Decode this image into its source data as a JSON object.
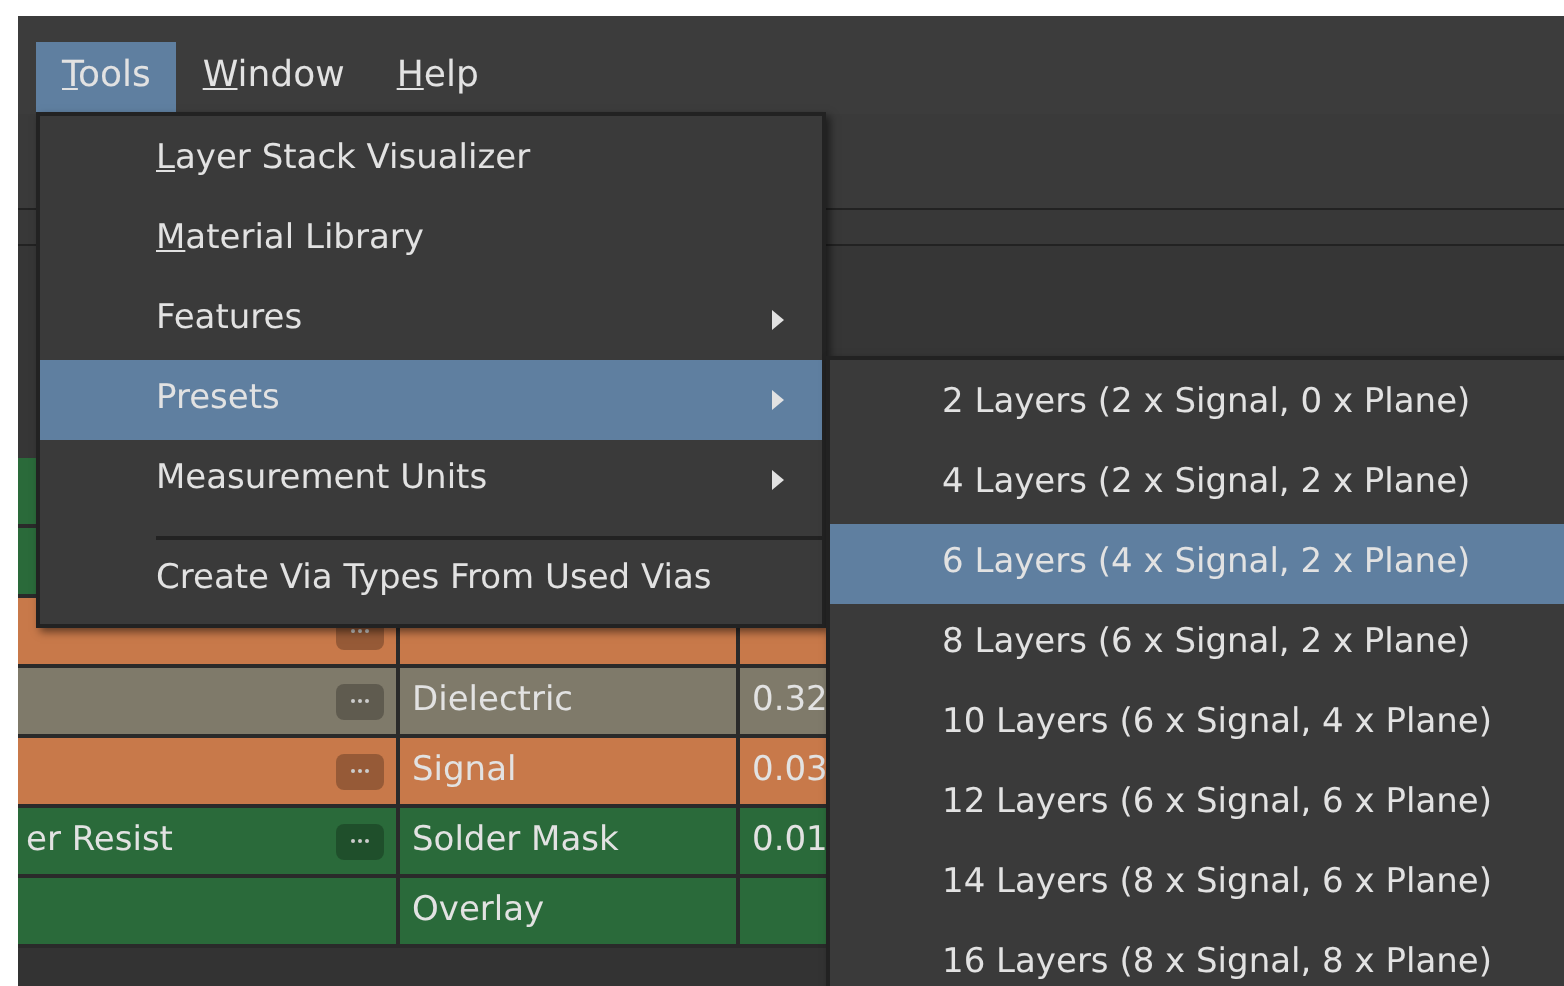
{
  "menu_bar": [
    {
      "label": "Tools",
      "underline_first": true,
      "selected": true
    },
    {
      "label": "Window",
      "underline_first": true,
      "selected": false
    },
    {
      "label": "Help",
      "underline_first": true,
      "selected": false
    }
  ],
  "table": {
    "rows": [
      {
        "color": "#2a6a3a",
        "name": "",
        "type": "",
        "thickness": "",
        "has_button": false
      },
      {
        "color": "#2a6a3a",
        "name": "",
        "type": "",
        "thickness": "",
        "has_button": false
      },
      {
        "color": "#c8794a",
        "name": "",
        "type": "",
        "thickness": "",
        "has_button": true
      },
      {
        "color": "#7f7a6a",
        "name": "",
        "type": "Dielectric",
        "thickness": "0.32",
        "has_button": true
      },
      {
        "color": "#c8794a",
        "name": "",
        "type": "Signal",
        "thickness": "0.03",
        "has_button": true
      },
      {
        "color": "#2a6a3a",
        "name": "er Resist",
        "type": "Solder Mask",
        "thickness": "0.01",
        "has_button": true
      },
      {
        "color": "#2a6a3a",
        "name": "",
        "type": "Overlay",
        "thickness": "",
        "has_button": false
      }
    ]
  },
  "tools_menu": [
    {
      "label": "Layer Stack Visualizer",
      "underline_first": true,
      "submenu": false,
      "selected": false,
      "separator_before": false
    },
    {
      "label": "Material Library",
      "underline_first": true,
      "submenu": false,
      "selected": false,
      "separator_before": false
    },
    {
      "label": "Features",
      "underline_first": false,
      "submenu": true,
      "selected": false,
      "separator_before": false
    },
    {
      "label": "Presets",
      "underline_first": false,
      "submenu": true,
      "selected": true,
      "separator_before": false
    },
    {
      "label": "Measurement Units",
      "underline_first": false,
      "submenu": true,
      "selected": false,
      "separator_before": false
    },
    {
      "label": "Create Via Types From Used Vias",
      "underline_first": false,
      "submenu": false,
      "selected": false,
      "separator_before": true
    }
  ],
  "presets_menu": [
    {
      "label": "2 Layers (2 x Signal, 0 x Plane)",
      "selected": false
    },
    {
      "label": "4 Layers (2 x Signal, 2 x Plane)",
      "selected": false
    },
    {
      "label": "6 Layers (4 x Signal, 2 x Plane)",
      "selected": true
    },
    {
      "label": "8 Layers (6 x Signal, 2 x Plane)",
      "selected": false
    },
    {
      "label": "10 Layers (6 x Signal, 4 x Plane)",
      "selected": false
    },
    {
      "label": "12 Layers (6 x Signal, 6 x Plane)",
      "selected": false
    },
    {
      "label": "14 Layers (8 x Signal, 6 x Plane)",
      "selected": false
    },
    {
      "label": "16 Layers (8 x Signal, 8 x Plane)",
      "selected": false
    }
  ]
}
